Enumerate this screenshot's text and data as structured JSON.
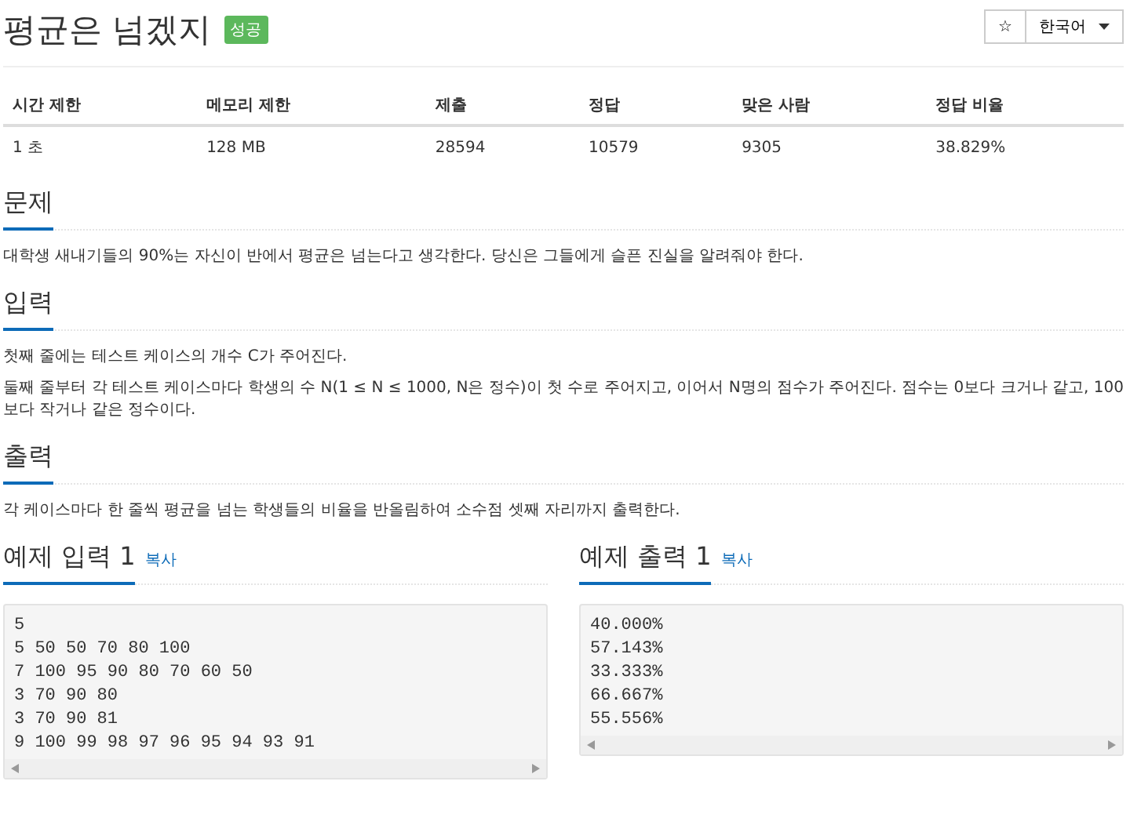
{
  "title": "평균은 넘겠지",
  "badge": "성공",
  "toolbar": {
    "star": "☆",
    "language": "한국어"
  },
  "table": {
    "columns": [
      "시간 제한",
      "메모리 제한",
      "제출",
      "정답",
      "맞은 사람",
      "정답 비율"
    ],
    "rows": [
      [
        "1 초",
        "128 MB",
        "28594",
        "10579",
        "9305",
        "38.829%"
      ]
    ]
  },
  "sections": [
    {
      "heading": "문제",
      "paragraphs": [
        "대학생 새내기들의 90%는 자신이 반에서 평균은 넘는다고 생각한다. 당신은 그들에게 슬픈 진실을 알려줘야 한다."
      ]
    },
    {
      "heading": "입력",
      "paragraphs": [
        "첫째 줄에는 테스트 케이스의 개수 C가 주어진다.",
        "둘째 줄부터 각 테스트 케이스마다 학생의 수 N(1 ≤ N ≤ 1000, N은 정수)이 첫 수로 주어지고, 이어서 N명의 점수가 주어진다. 점수는 0보다 크거나 같고, 100보다 작거나 같은 정수이다."
      ]
    },
    {
      "heading": "출력",
      "paragraphs": [
        "각 케이스마다 한 줄씩 평균을 넘는 학생들의 비율을 반올림하여 소수점 셋째 자리까지 출력한다."
      ]
    }
  ],
  "samples": [
    {
      "heading": "예제 입력 1",
      "copy": "복사",
      "lines": [
        "5",
        "5 50 50 70 80 100",
        "7 100 95 90 80 70 60 50",
        "3 70 90 80",
        "3 70 90 81",
        "9 100 99 98 97 96 95 94 93 91"
      ]
    },
    {
      "heading": "예제 출력 1",
      "copy": "복사",
      "lines": [
        "40.000%",
        "57.143%",
        "33.333%",
        "66.667%",
        "55.556%"
      ]
    }
  ]
}
